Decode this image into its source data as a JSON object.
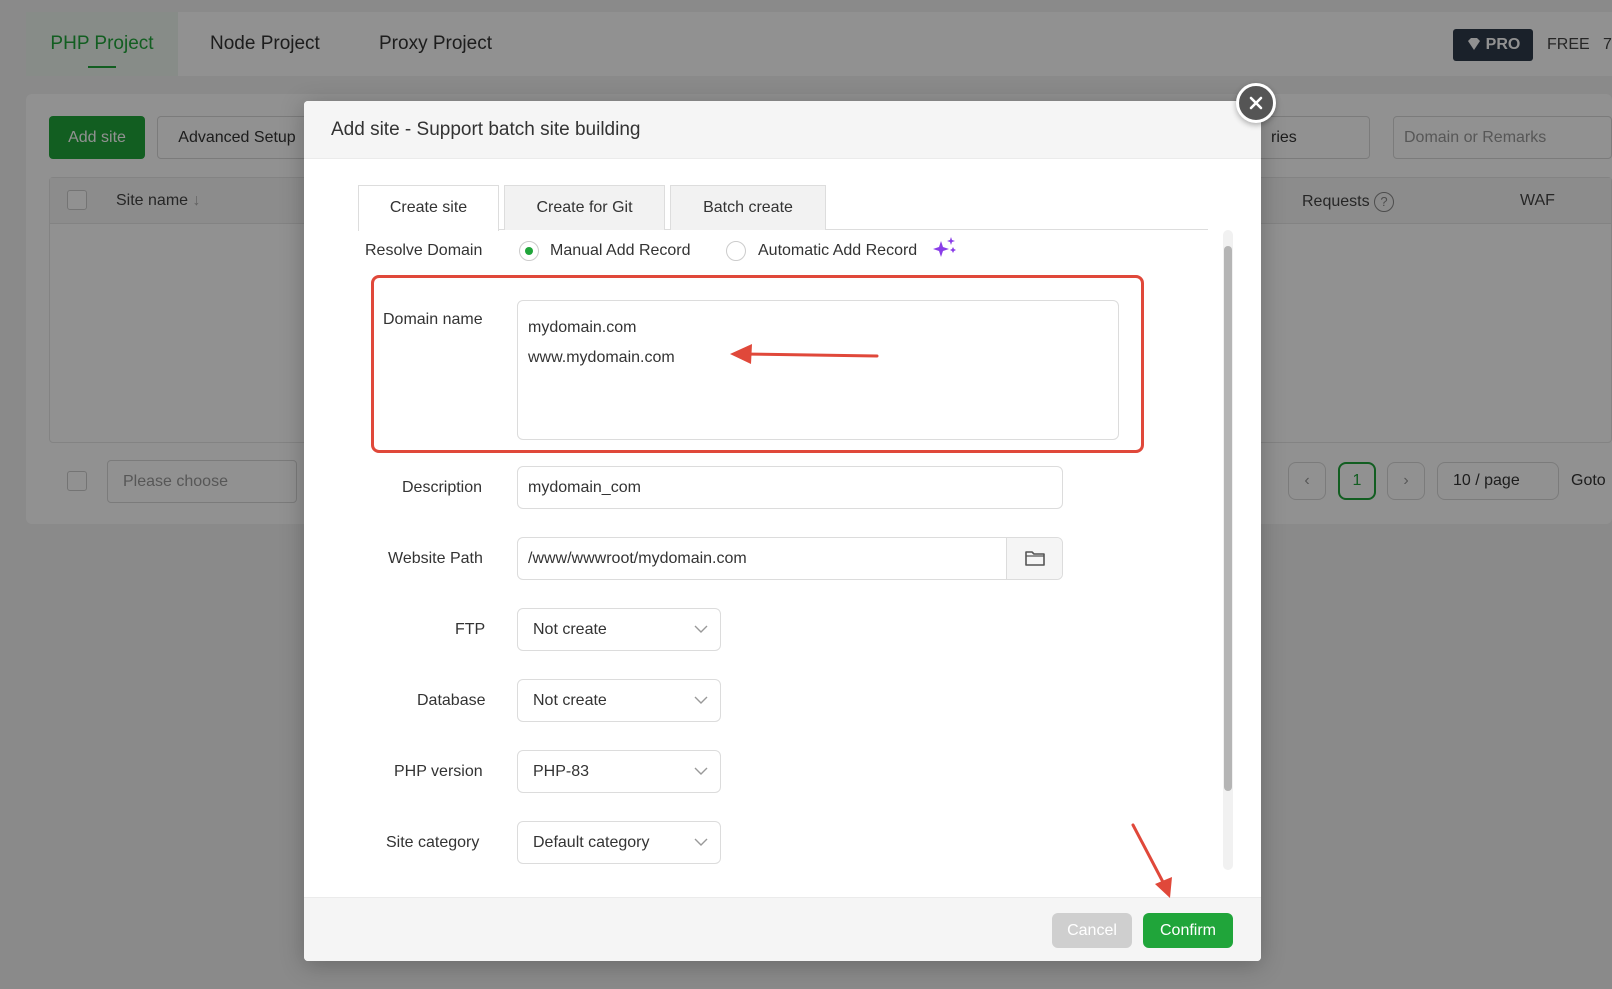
{
  "background": {
    "tabs": [
      "PHP Project",
      "Node Project",
      "Proxy Project"
    ],
    "pro_label": "PRO",
    "free_label": "FREE",
    "free_version": "7.",
    "add_site_button": "Add site",
    "advanced_setup_button": "Advanced Setup",
    "category_select": "ries",
    "search_placeholder": "Domain or Remarks",
    "table_headers": {
      "site_name": "Site name",
      "requests": "Requests",
      "waf": "WAF"
    },
    "batch_select": "Please choose",
    "pagination": {
      "current_page": "1",
      "page_size": "10 / page",
      "goto": "Goto"
    }
  },
  "modal": {
    "title": "Add site - Support batch site building",
    "tabs": [
      "Create site",
      "Create for Git",
      "Batch create"
    ],
    "resolve_domain": {
      "label": "Resolve Domain",
      "options": [
        "Manual Add Record",
        "Automatic Add Record"
      ],
      "selected": "Manual Add Record"
    },
    "domain_name": {
      "label": "Domain name",
      "lines": [
        "mydomain.com",
        "www.mydomain.com"
      ]
    },
    "description": {
      "label": "Description",
      "value": "mydomain_com"
    },
    "website_path": {
      "label": "Website Path",
      "value": "/www/wwwroot/mydomain.com"
    },
    "ftp": {
      "label": "FTP",
      "value": "Not create"
    },
    "database": {
      "label": "Database",
      "value": "Not create"
    },
    "php_version": {
      "label": "PHP version",
      "value": "PHP-83"
    },
    "site_category": {
      "label": "Site category",
      "value": "Default category"
    },
    "cancel_label": "Cancel",
    "confirm_label": "Confirm"
  },
  "colors": {
    "accent": "#20a53a",
    "annotation": "#e0483a",
    "sparkle": "#8a3ee8"
  }
}
